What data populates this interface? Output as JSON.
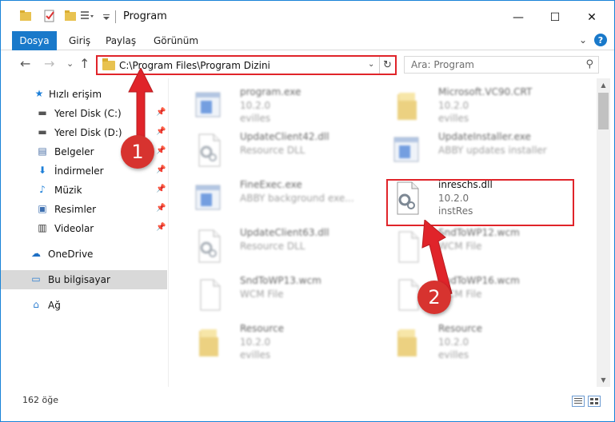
{
  "window": {
    "title": "Program",
    "controls": {
      "minimize": "—",
      "maximize": "☐",
      "close": "✕"
    }
  },
  "ribbon": {
    "tabs": [
      "Dosya",
      "Giriş",
      "Paylaş",
      "Görünüm"
    ],
    "expand": "⌄",
    "help": "?"
  },
  "nav": {
    "back": "←",
    "forward": "→",
    "recent": "⌄",
    "up": "↑",
    "address": "C:\\Program Files\\Program Dizini",
    "address_dropdown": "⌄",
    "refresh": "↻",
    "search_placeholder": "Ara: Program",
    "search_icon": "⚲"
  },
  "sidebar": {
    "items": [
      {
        "label": "Hızlı erişim",
        "icon": "star-icon",
        "glyph": "★",
        "color": "#1d7fd8",
        "pinned": false
      },
      {
        "label": "Yerel Disk (C:)",
        "icon": "drive-icon",
        "glyph": "▬",
        "color": "#555555",
        "pinned": true
      },
      {
        "label": "Yerel Disk (D:)",
        "icon": "drive-icon",
        "glyph": "▬",
        "color": "#555555",
        "pinned": true
      },
      {
        "label": "Belgeler",
        "icon": "documents-icon",
        "glyph": "▤",
        "color": "#4a6fa5",
        "pinned": true
      },
      {
        "label": "İndirmeler",
        "icon": "download-icon",
        "glyph": "⬇",
        "color": "#1d7fd8",
        "pinned": true
      },
      {
        "label": "Müzik",
        "icon": "music-icon",
        "glyph": "♪",
        "color": "#1d7fd8",
        "pinned": true
      },
      {
        "label": "Resimler",
        "icon": "pictures-icon",
        "glyph": "▣",
        "color": "#3d6fb0",
        "pinned": true
      },
      {
        "label": "Videolar",
        "icon": "video-icon",
        "glyph": "▥",
        "color": "#333333",
        "pinned": true
      },
      {
        "label": "OneDrive",
        "icon": "cloud-icon",
        "glyph": "☁",
        "color": "#1d6fc4",
        "pinned": false
      },
      {
        "label": "Bu bilgisayar",
        "icon": "computer-icon",
        "glyph": "▭",
        "color": "#2f7fd1",
        "pinned": false
      },
      {
        "label": "Ağ",
        "icon": "network-icon",
        "glyph": "⌂",
        "color": "#2f7fd1",
        "pinned": false
      }
    ],
    "pin_glyph": "📌"
  },
  "files": [
    {
      "name": "program.exe",
      "line2": "10.2.0",
      "line3": "evilles",
      "type": "exe",
      "blur": true
    },
    {
      "name": "Microsoft.VC90.CRT",
      "line2": "10.2.0",
      "line3": "evilles",
      "type": "folder",
      "blur": true
    },
    {
      "name": "UpdateClient42.dll",
      "line2": "Resource DLL",
      "line3": "",
      "type": "dll",
      "blur": true
    },
    {
      "name": "UpdateInstaller.exe",
      "line2": "ABBY updates installer",
      "line3": "",
      "type": "exe",
      "blur": true
    },
    {
      "name": "FineExec.exe",
      "line2": "ABBY background exe...",
      "line3": "",
      "type": "exe",
      "blur": true
    },
    {
      "name": "inreschs.dll",
      "line2": "10.2.0",
      "line3": "instRes",
      "type": "dll",
      "blur": false
    },
    {
      "name": "UpdateClient63.dll",
      "line2": "Resource DLL",
      "line3": "",
      "type": "dll",
      "blur": true
    },
    {
      "name": "SndToWP12.wcm",
      "line2": "WCM File",
      "line3": "",
      "type": "doc",
      "blur": true
    },
    {
      "name": "SndToWP13.wcm",
      "line2": "WCM File",
      "line3": "",
      "type": "doc",
      "blur": true
    },
    {
      "name": "SndToWP16.wcm",
      "line2": "WCM File",
      "line3": "",
      "type": "doc",
      "blur": true
    },
    {
      "name": "Resource",
      "line2": "10.2.0",
      "line3": "evilles",
      "type": "folder",
      "blur": true
    },
    {
      "name": "Resource",
      "line2": "10.2.0",
      "line3": "evilles",
      "type": "folder",
      "blur": true
    }
  ],
  "status": {
    "count": "162 öğe"
  },
  "callouts": {
    "one": "1",
    "two": "2"
  },
  "colors": {
    "accent": "#1979ca",
    "highlight": "#e0242a",
    "badge": "#d7332f"
  }
}
